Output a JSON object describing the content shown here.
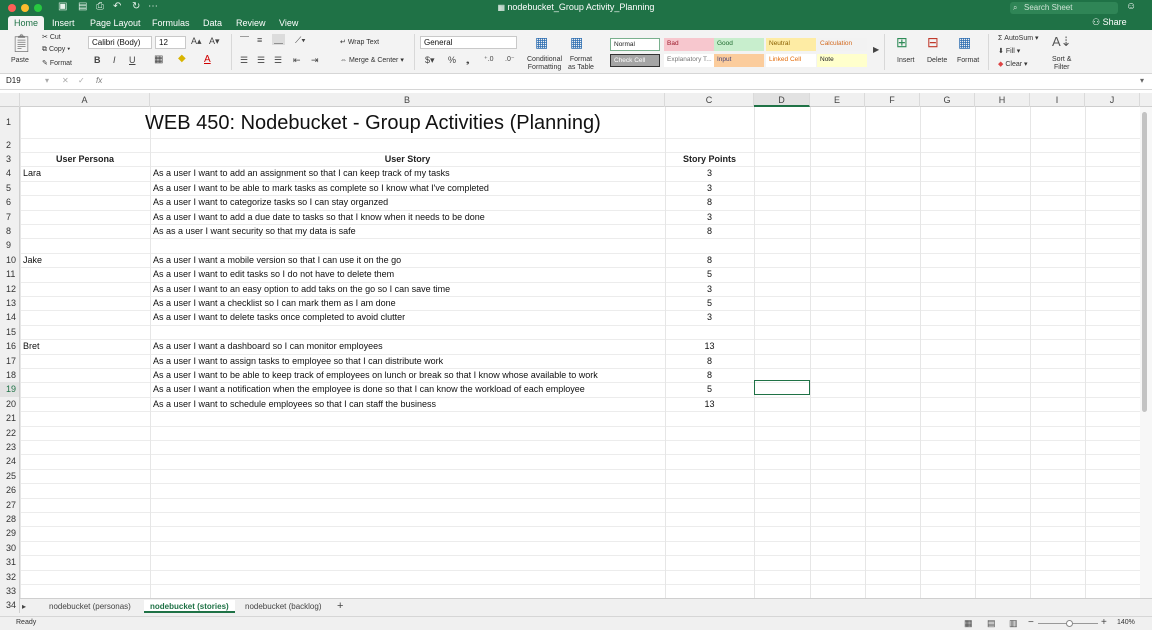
{
  "window": {
    "title": "nodebucket_Group Activity_Planning",
    "search_placeholder": "Search Sheet",
    "share_label": "Share"
  },
  "tabs": [
    "Home",
    "Insert",
    "Page Layout",
    "Formulas",
    "Data",
    "Review",
    "View"
  ],
  "ribbon": {
    "paste": "Paste",
    "cut": "Cut",
    "copy": "Copy",
    "format_painter": "Format",
    "font_name": "Calibri (Body)",
    "font_size": "12",
    "wrap_text": "Wrap Text",
    "merge_center": "Merge & Center",
    "number_format": "General",
    "conditional_formatting": [
      "Conditional",
      "Formatting"
    ],
    "format_as_table": [
      "Format",
      "as Table"
    ],
    "styles": [
      {
        "label": "Normal",
        "bg": "#ffffff",
        "fg": "#222222"
      },
      {
        "label": "Bad",
        "bg": "#f7c7ce",
        "fg": "#9c1b2c"
      },
      {
        "label": "Good",
        "bg": "#c8eecd",
        "fg": "#1e6b2e"
      },
      {
        "label": "Neutral",
        "bg": "#feeca4",
        "fg": "#8a5f00"
      },
      {
        "label": "Calculation",
        "bg": "#f2f2f2",
        "fg": "#d2691e"
      },
      {
        "label": "Check Cell",
        "bg": "#a5a5a5",
        "fg": "#ffffff"
      },
      {
        "label": "Explanatory T...",
        "bg": "#ffffff",
        "fg": "#777777"
      },
      {
        "label": "Input",
        "bg": "#fbcc9c",
        "fg": "#3f3f76"
      },
      {
        "label": "Linked Cell",
        "bg": "#ffffff",
        "fg": "#e46c0a"
      },
      {
        "label": "Note",
        "bg": "#ffffcc",
        "fg": "#222222"
      }
    ],
    "insert": "Insert",
    "delete": "Delete",
    "format": "Format",
    "autosum": "AutoSum",
    "fill": "Fill",
    "clear": "Clear",
    "sort_filter": [
      "Sort &",
      "Filter"
    ]
  },
  "formula_bar": {
    "name_box": "D19",
    "fx": "fx",
    "value": ""
  },
  "columns": [
    "A",
    "B",
    "C",
    "D",
    "E",
    "F",
    "G",
    "H",
    "I",
    "J"
  ],
  "row_numbers": [
    "1",
    "2",
    "3",
    "4",
    "5",
    "6",
    "7",
    "8",
    "9",
    "10",
    "11",
    "12",
    "13",
    "14",
    "15",
    "16",
    "17",
    "18",
    "19",
    "20",
    "21",
    "22",
    "23",
    "24",
    "25",
    "26",
    "27",
    "28",
    "29",
    "30",
    "31",
    "32",
    "33",
    "34"
  ],
  "sheet": {
    "title": "WEB 450: Nodebucket - Group Activities (Planning)",
    "headers": {
      "persona": "User Persona",
      "story": "User Story",
      "points": "Story Points"
    },
    "rows": [
      {
        "persona": "Lara",
        "story": "As a user I want to add an assignment so that I can keep track of my tasks",
        "points": "3"
      },
      {
        "persona": "",
        "story": "As a user I want to be able to mark tasks as complete so I know what I've completed",
        "points": "3"
      },
      {
        "persona": "",
        "story": "As a user I want to categorize tasks so I can stay organzed",
        "points": "8"
      },
      {
        "persona": "",
        "story": "As a user I want to add a due date to tasks so that I know when it needs to be done",
        "points": "3"
      },
      {
        "persona": "",
        "story": "As as a user I want security so that my data is safe",
        "points": "8"
      },
      {
        "persona": "",
        "story": "",
        "points": ""
      },
      {
        "persona": "Jake",
        "story": "As a user I want a mobile version so that I can use it on the go",
        "points": "8"
      },
      {
        "persona": "",
        "story": "As a user I want to edit tasks so I do not have to delete them",
        "points": "5"
      },
      {
        "persona": "",
        "story": "As a user I want to an easy option to add taks on the go so I can save time",
        "points": "3"
      },
      {
        "persona": "",
        "story": "As a user I want a checklist so I can mark them as I am done",
        "points": "5"
      },
      {
        "persona": "",
        "story": "As a user I want to delete tasks once completed to avoid clutter",
        "points": "3"
      },
      {
        "persona": "",
        "story": "",
        "points": ""
      },
      {
        "persona": "Bret",
        "story": "As a user I want a dashboard so I can monitor employees",
        "points": "13"
      },
      {
        "persona": "",
        "story": "As a user I want to assign tasks to employee so that I can distribute work",
        "points": "8"
      },
      {
        "persona": "",
        "story": "As a user I want to be able to keep track of employees on lunch or break so that I know whose available to work",
        "points": "8"
      },
      {
        "persona": "",
        "story": "As a user I want a notification when the employee is done so that I can know the workload of each employee",
        "points": "5"
      },
      {
        "persona": "",
        "story": "As a user I want to schedule employees so that I can staff the business",
        "points": "13"
      }
    ]
  },
  "sheet_tabs": [
    "nodebucket (personas)",
    "nodebucket (stories)",
    "nodebucket (backlog)"
  ],
  "active_sheet_tab": "nodebucket (stories)",
  "status": {
    "ready": "Ready",
    "zoom": "140%"
  },
  "colors": {
    "brand": "#1f7246"
  }
}
